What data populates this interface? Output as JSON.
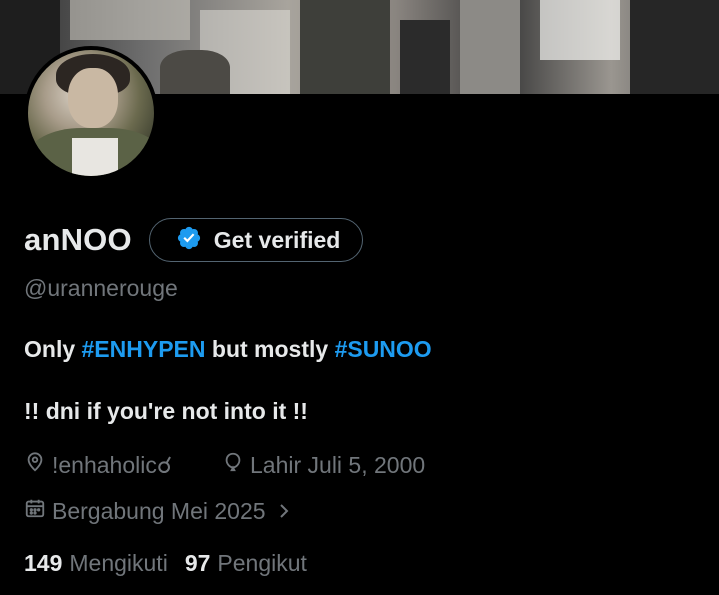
{
  "profile": {
    "display_name": "anNOO",
    "verify_label": "Get verified",
    "handle": "@urannerouge",
    "bio": {
      "line1_prefix": "Only ",
      "tag1": "#ENHYPEN",
      "line1_middle": " but mostly ",
      "tag2": "#SUNOO",
      "line2": "!! dni if you're not into it !!"
    },
    "location": "!enhaholic☌",
    "birth": "Lahir Juli 5, 2000",
    "joined": "Bergabung Mei 2025",
    "following_count": "149",
    "following_label": "Mengikuti",
    "followers_count": "97",
    "followers_label": "Pengikut"
  },
  "icons": {
    "verified": "verified-badge-icon",
    "location": "location-pin-icon",
    "birth": "balloon-icon",
    "joined": "calendar-icon",
    "chevron": "chevron-right-icon"
  },
  "colors": {
    "background": "#000000",
    "text_primary": "#e7e9ea",
    "text_secondary": "#71767b",
    "accent": "#1d9bf0",
    "border": "#536471"
  }
}
